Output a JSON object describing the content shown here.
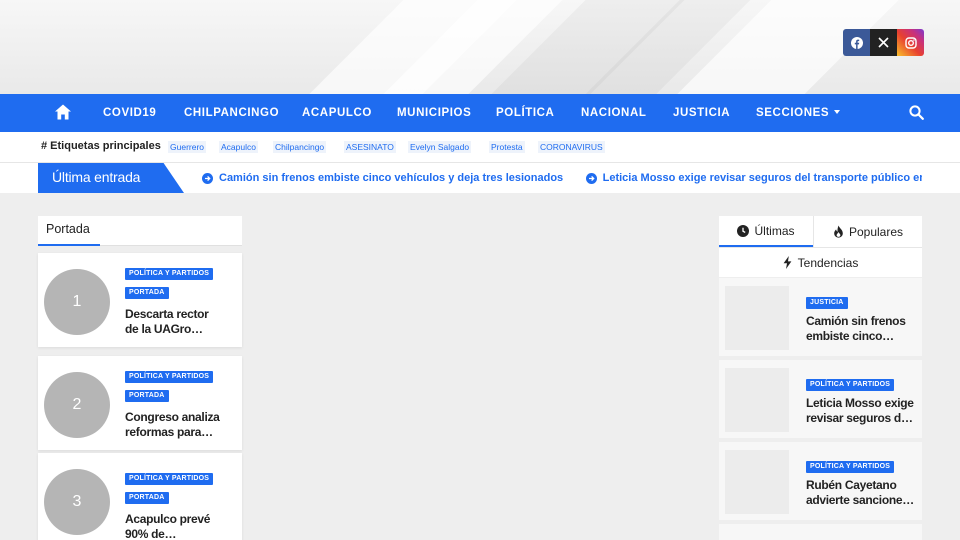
{
  "social": {
    "icons": [
      "facebook-icon",
      "x-icon",
      "instagram-icon"
    ],
    "colors": {
      "facebook": "#3b5998",
      "x": "#222222"
    }
  },
  "nav": {
    "accent": "#1f6cf0",
    "items": [
      "COVID19",
      "CHILPANCINGO",
      "ACAPULCO",
      "MUNICIPIOS",
      "POLÍTICA",
      "NACIONAL",
      "JUSTICIA",
      "SECCIONES"
    ]
  },
  "tags": {
    "heading": "# Etiquetas principales",
    "items": [
      "Guerrero",
      "Acapulco",
      "Chilpancingo",
      "ASESINATO",
      "Evelyn Salgado",
      "Protesta",
      "CORONAVIRUS"
    ]
  },
  "ticker": {
    "label": "Última entrada",
    "items": [
      "Camión sin frenos embiste cinco vehículos y deja tres lesionados",
      "Leticia Mosso exige revisar seguros del transporte público en Guerr"
    ]
  },
  "portada": {
    "title": "Portada",
    "posts": [
      {
        "number": "1",
        "categories": [
          "POLÍTICA Y PARTIDOS",
          "PORTADA"
        ],
        "title_lines": [
          "Descarta rector",
          "de la UAGro…"
        ]
      },
      {
        "number": "2",
        "categories": [
          "POLÍTICA Y PARTIDOS",
          "PORTADA"
        ],
        "title_lines": [
          "Congreso analiza",
          "reformas para…"
        ]
      },
      {
        "number": "3",
        "categories": [
          "POLÍTICA Y PARTIDOS",
          "PORTADA"
        ],
        "title_lines": [
          "Acapulco prevé",
          "90% de…"
        ]
      }
    ]
  },
  "sidebar": {
    "tabs": [
      "Últimas",
      "Populares"
    ],
    "tab_secondary": "Tendencias",
    "posts": [
      {
        "category": "JUSTICIA",
        "title_lines": [
          "Camión sin frenos",
          "embiste cinco…"
        ]
      },
      {
        "category": "POLÍTICA Y PARTIDOS",
        "title_lines": [
          "Leticia Mosso exige",
          "revisar seguros d…"
        ]
      },
      {
        "category": "POLÍTICA Y PARTIDOS",
        "title_lines": [
          "Rubén Cayetano",
          "advierte sancione…"
        ]
      }
    ]
  }
}
